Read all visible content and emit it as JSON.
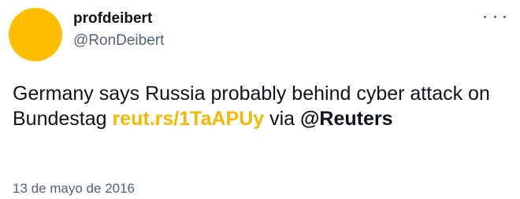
{
  "tweet": {
    "author": {
      "display_name": "profdeibert",
      "handle": "@RonDeibert",
      "avatar_color": "#FFBF00"
    },
    "menu_icon": "more-horizontal-icon",
    "text": {
      "part1": "Germany says Russia probably behind cyber attack on Bundestag ",
      "link": "reut.rs/1TaAPUy",
      "part2": " via ",
      "mention": "@Reuters"
    },
    "timestamp": "13 de mayo de 2016"
  },
  "colors": {
    "link": "#F5B800",
    "secondary_text": "#536471",
    "primary_text": "#0f1419"
  }
}
